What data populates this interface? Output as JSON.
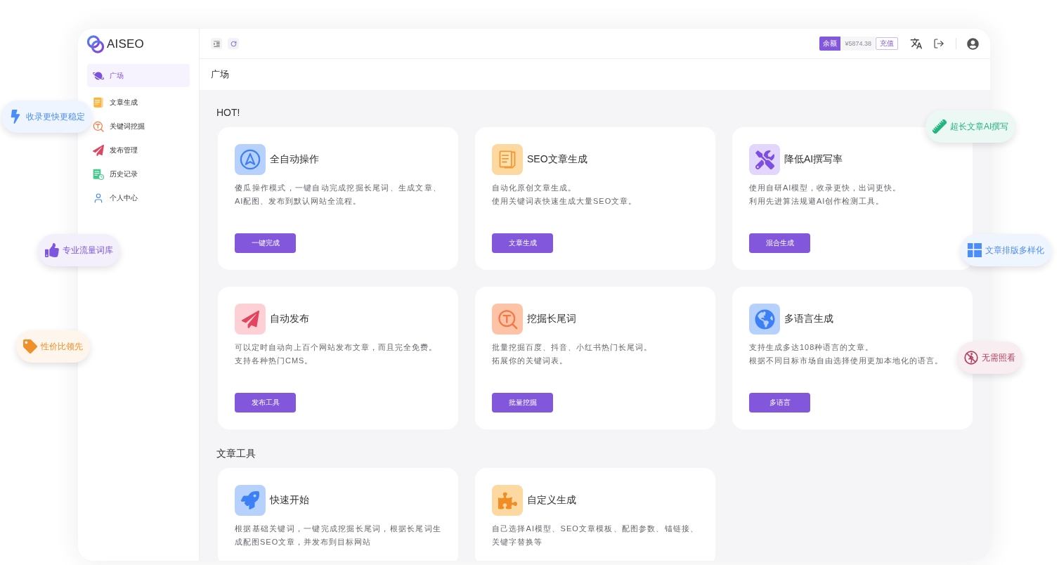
{
  "sidebar": {
    "logo_text": "AISEO",
    "items": [
      {
        "label": "广场",
        "selected": true
      },
      {
        "label": "文章生成",
        "selected": false
      },
      {
        "label": "关键词挖掘",
        "selected": false
      },
      {
        "label": "发布管理",
        "selected": false
      },
      {
        "label": "历史记录",
        "selected": false
      },
      {
        "label": "个人中心",
        "selected": false
      }
    ]
  },
  "top_bar": {
    "balance_label": "余额",
    "balance": "¥5874.38",
    "recharge_button": "充值"
  },
  "breadcrumb": "广场",
  "sections": [
    {
      "title": "HOT!",
      "cards": [
        {
          "title": "全自动操作",
          "description": [
            "傻瓜操作模式，一键自动完成挖掘长尾词、生成文章、AI配图、发布到默认网站全流程。"
          ],
          "button": "一键完成"
        },
        {
          "title": "SEO文章生成",
          "description": [
            "自动化原创文章生成。",
            "使用关键词表快速生成大量SEO文章。"
          ],
          "button": "文章生成"
        },
        {
          "title": "降低AI撰写率",
          "description": [
            "使用自研AI模型，收录更快，出词更快。",
            "利用先进算法规避AI创作检测工具。"
          ],
          "button": "混合生成"
        },
        {
          "title": "自动发布",
          "description": [
            "可以定时自动向上百个网站发布文章，而且完全免费。",
            "支持各种热门CMS。"
          ],
          "button": "发布工具"
        },
        {
          "title": "挖掘长尾词",
          "description": [
            "批量挖掘百度、抖音、小红书热门长尾词。",
            "拓展你的关键词表。"
          ],
          "button": "批量挖掘"
        },
        {
          "title": "多语言生成",
          "description": [
            "支持生成多达108种语言的文章。",
            "根据不同目标市场自由选择使用更加本地化的语言。"
          ],
          "button": "多语言"
        }
      ]
    },
    {
      "title": "文章工具",
      "cards": [
        {
          "title": "快速开始",
          "description": [
            "根据基础关键词，一键完成挖掘长尾词，根据长尾词生成配图SEO文章，并发布到目标网站"
          ]
        },
        {
          "title": "自定义生成",
          "description": [
            "自己选择AI模型、SEO文章模板、配图参数、锚链接、关键字替换等"
          ]
        }
      ]
    }
  ],
  "feature_badges": [
    {
      "label": "收录更快更稳定",
      "color": "#4a8ff7"
    },
    {
      "label": "专业流量词库",
      "color": "#7d55e0"
    },
    {
      "label": "性价比领先",
      "color": "#f0902a"
    },
    {
      "label": "超长文章AI撰写",
      "color": "#22b57f"
    },
    {
      "label": "文章排版多样化",
      "color": "#4d8df7"
    },
    {
      "label": "无需照看",
      "color": "#b23a5a"
    }
  ]
}
